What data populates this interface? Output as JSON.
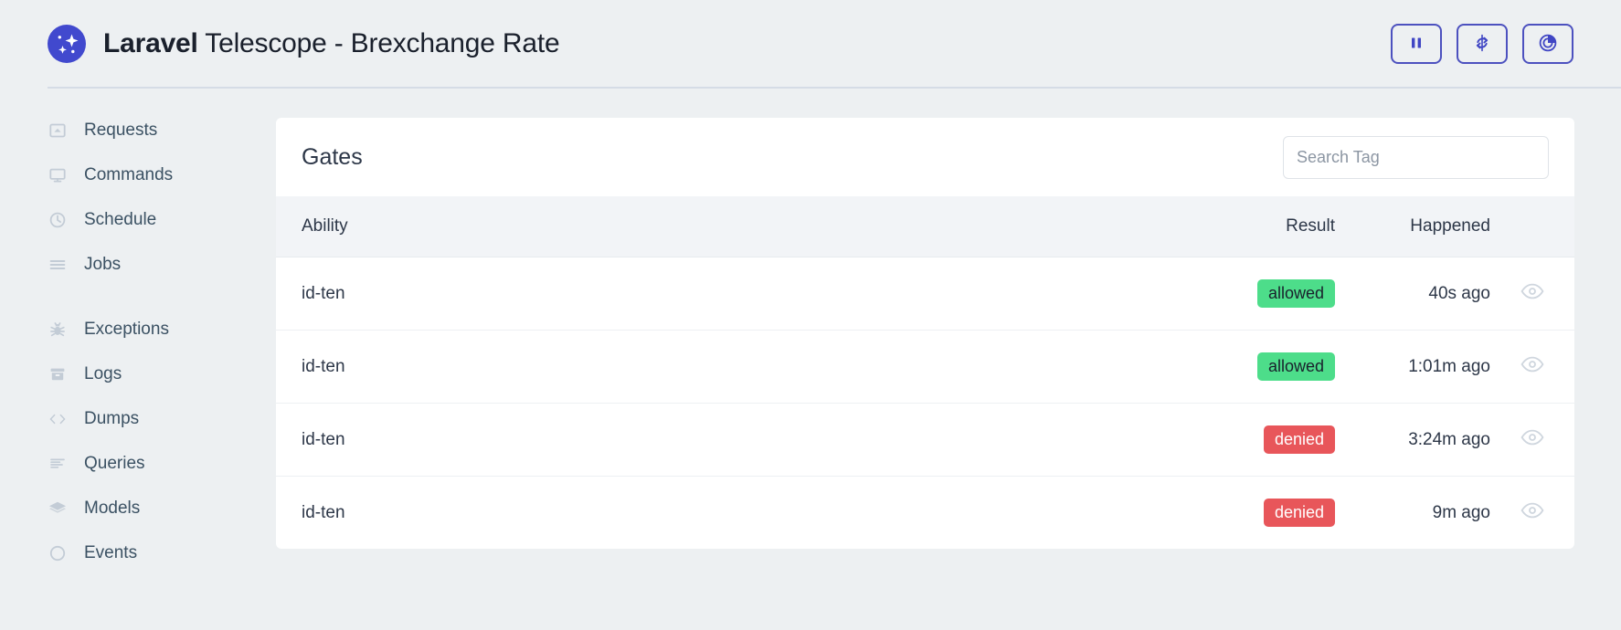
{
  "header": {
    "logo_icon": "telescope-sparkle-logo",
    "title_strong": "Laravel",
    "title_light": " Telescope - Brexchange Rate",
    "actions": [
      {
        "name": "pause-button",
        "icon": "pause-icon"
      },
      {
        "name": "refresh-button",
        "icon": "refresh-icon"
      },
      {
        "name": "telescope-chart-button",
        "icon": "pie-chart-icon"
      }
    ],
    "accent_color": "#4c51bf"
  },
  "sidebar": {
    "items": [
      {
        "label": "Requests",
        "icon": "inbox-icon"
      },
      {
        "label": "Commands",
        "icon": "monitor-icon"
      },
      {
        "label": "Schedule",
        "icon": "clock-icon"
      },
      {
        "label": "Jobs",
        "icon": "list-lines-icon"
      },
      {
        "label": "Exceptions",
        "icon": "bug-icon"
      },
      {
        "label": "Logs",
        "icon": "archive-box-icon"
      },
      {
        "label": "Dumps",
        "icon": "code-brackets-icon"
      },
      {
        "label": "Queries",
        "icon": "text-lines-icon"
      },
      {
        "label": "Models",
        "icon": "layers-icon"
      },
      {
        "label": "Events",
        "icon": "circle-icon"
      }
    ]
  },
  "card": {
    "title": "Gates",
    "search": {
      "placeholder": "Search Tag",
      "value": ""
    },
    "columns": {
      "ability": "Ability",
      "result": "Result",
      "happened": "Happened"
    },
    "rows": [
      {
        "ability": "id-ten",
        "result": "allowed",
        "result_state": "allowed",
        "happened": "40s ago",
        "view_icon": "eye-icon"
      },
      {
        "ability": "id-ten",
        "result": "allowed",
        "result_state": "allowed",
        "happened": "1:01m ago",
        "view_icon": "eye-icon"
      },
      {
        "ability": "id-ten",
        "result": "denied",
        "result_state": "denied",
        "happened": "3:24m ago",
        "view_icon": "eye-icon"
      },
      {
        "ability": "id-ten",
        "result": "denied",
        "result_state": "denied",
        "happened": "9m ago",
        "view_icon": "eye-icon"
      }
    ],
    "colors": {
      "allowed_bg": "#4ddd8a",
      "denied_bg": "#e8565a"
    }
  }
}
